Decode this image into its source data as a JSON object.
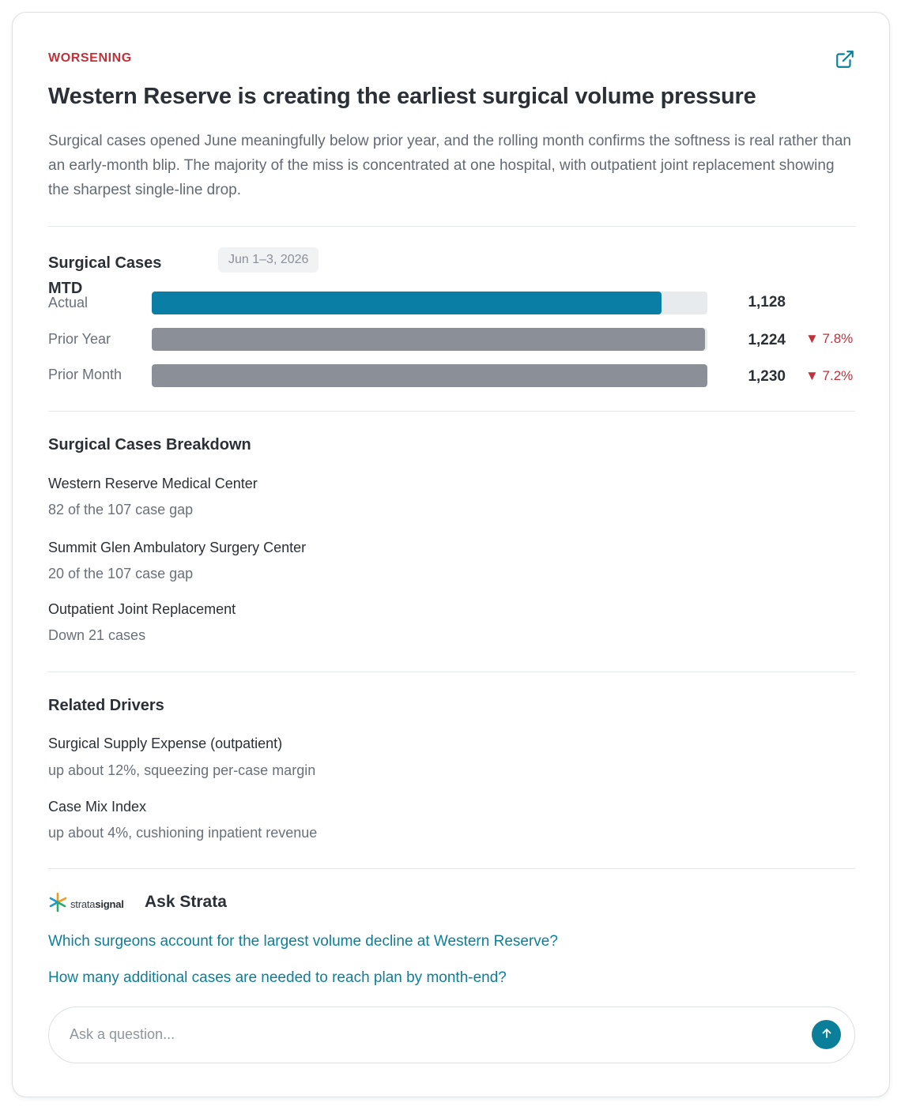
{
  "insight": {
    "status": "WORSENING",
    "status_color": "#c0313b",
    "open_icon": "external-link-icon",
    "title": "Western Reserve is creating the earliest surgical volume pressure",
    "description": "Surgical cases opened June meaningfully below prior year, and the rolling month confirms the softness is real rather than an early-month blip. The majority of the miss is concentrated at one hospital, with outpatient joint replacement showing the sharpest single-line drop."
  },
  "metric": {
    "title": "Surgical Cases MTD",
    "date_range": "Jun 1–3, 2026",
    "bars": [
      {
        "label": "Actual",
        "value": 1128,
        "value_text": "1,128",
        "change": "",
        "color": "#0a7ea4"
      },
      {
        "label": "Prior Year",
        "value": 1224,
        "value_text": "1,224",
        "change": "▼ 7.8%",
        "color": "#8a8f98"
      },
      {
        "label": "Prior Month",
        "value": 1230,
        "value_text": "1,230",
        "change": "▼ 7.2%",
        "color": "#8a8f98"
      }
    ],
    "change_color": "#c0313b"
  },
  "breakdown": {
    "heading": "Surgical Cases Breakdown",
    "items": [
      {
        "name": "Western Reserve Medical Center",
        "detail": "82 of the 107 case gap"
      },
      {
        "name": "Summit Glen Ambulatory Surgery Center",
        "detail": "20 of the 107 case gap"
      },
      {
        "name": "Outpatient Joint Replacement",
        "detail": "Down 21 cases"
      }
    ]
  },
  "drivers": {
    "heading": "Related Drivers",
    "items": [
      {
        "name": "Surgical Supply Expense (outpatient)",
        "detail": "up about 12%, squeezing per-case margin"
      },
      {
        "name": "Case Mix Index",
        "detail": "up about 4%, cushioning inpatient revenue"
      }
    ]
  },
  "ask": {
    "logo_text_light": "strata",
    "logo_text_bold": "signal",
    "logo_icon": "stratasignal-logo-icon",
    "title": "Ask Strata",
    "suggestions": [
      "Which surgeons account for the largest volume decline at Western Reserve?",
      "How many additional cases are needed to reach plan by month-end?"
    ],
    "input_placeholder": "Ask a question...",
    "send_icon": "arrow-up-icon",
    "accent": "#0b7f9a"
  }
}
